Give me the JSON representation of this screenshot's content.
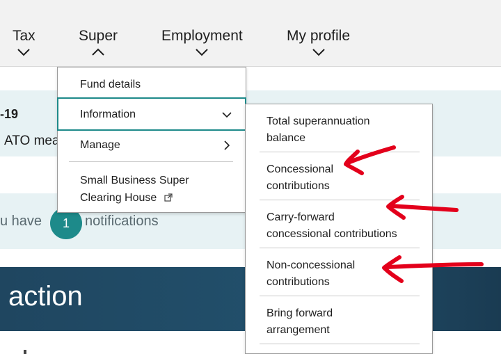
{
  "nav": {
    "tax": "Tax",
    "super": "Super",
    "employment": "Employment",
    "my_profile": "My profile"
  },
  "content": {
    "year_fragment": "-19",
    "ato_fragment": "ATO mea",
    "notifications_prefix": "u have",
    "notifications_count": "1",
    "notifications_suffix": "notifications",
    "action_title": "action"
  },
  "super_menu": {
    "fund_details": "Fund details",
    "information": "Information",
    "manage": "Manage",
    "sbsch_line1": "Small Business Super",
    "sbsch_line2": "Clearing House"
  },
  "information_menu": {
    "items": [
      {
        "line1": "Total superannuation",
        "line2": "balance"
      },
      {
        "line1": "Concessional",
        "line2": "contributions"
      },
      {
        "line1": "Carry-forward",
        "line2": "concessional contributions"
      },
      {
        "line1": "Non-concessional",
        "line2": "contributions"
      },
      {
        "line1": "Bring forward",
        "line2": "arrangement"
      }
    ]
  },
  "colors": {
    "accent_teal": "#1d8a8a",
    "annotation_red": "#e3001b",
    "banner_navy": "#22506c"
  },
  "icons": {
    "tax_chevron": "chevron-down-icon",
    "super_chevron": "chevron-up-icon",
    "information_chevron": "chevron-down-icon",
    "manage_chevron": "chevron-right-icon",
    "external_link": "external-link-icon"
  }
}
